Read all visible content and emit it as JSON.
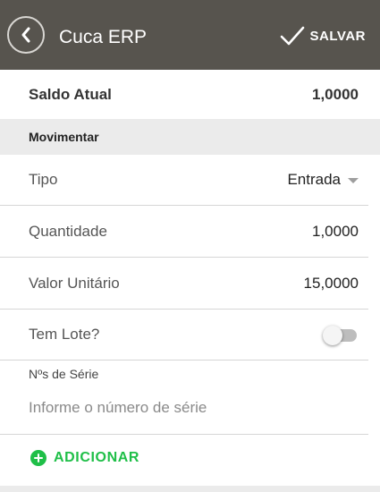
{
  "header": {
    "title": "Cuca ERP",
    "save_label": "SALVAR",
    "background_color": "#57544e"
  },
  "saldo": {
    "label": "Saldo Atual",
    "value": "1,0000"
  },
  "section": {
    "title": "Movimentar"
  },
  "fields": {
    "tipo": {
      "label": "Tipo",
      "value": "Entrada"
    },
    "quantidade": {
      "label": "Quantidade",
      "value": "1,0000"
    },
    "valor_unitario": {
      "label": "Valor Unitário",
      "value": "15,0000"
    },
    "tem_lote": {
      "label": "Tem Lote?",
      "checked": false
    }
  },
  "serie": {
    "label": "Nºs de Série",
    "placeholder": "Informe o número de série",
    "value": ""
  },
  "add_button": {
    "label": "ADICIONAR",
    "color": "#1fbf48"
  }
}
